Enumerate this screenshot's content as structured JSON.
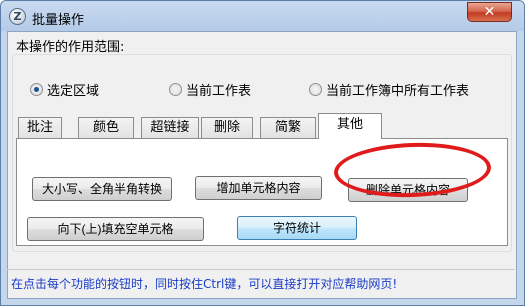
{
  "window": {
    "title": "批量操作",
    "icon_glyph": "Z",
    "close_glyph": "✕"
  },
  "scope": {
    "label": "本操作的作用范围:",
    "options": [
      {
        "label": "选定区域",
        "selected": true
      },
      {
        "label": "当前工作表",
        "selected": false
      },
      {
        "label": "当前工作簿中所有工作表",
        "selected": false
      }
    ]
  },
  "tabs": [
    {
      "label": "批注",
      "active": false
    },
    {
      "label": "颜色",
      "active": false
    },
    {
      "label": "超链接",
      "active": false
    },
    {
      "label": "删除",
      "active": false
    },
    {
      "label": "简繁",
      "active": false
    },
    {
      "label": "其他",
      "active": true
    }
  ],
  "buttons": {
    "case_convert": "大小写、全角半角转换",
    "add_content": "增加单元格内容",
    "delete_content": "删除单元格内容",
    "fill_empty": "向下(上)填充空单元格",
    "char_stats": "字符统计"
  },
  "hint": "在点击每个功能的按钮时，同时按住Ctrl键，可以直接打开对应帮助网页!",
  "colors": {
    "annotation": "#e01b1b",
    "hint_text": "#1a3cc8"
  }
}
